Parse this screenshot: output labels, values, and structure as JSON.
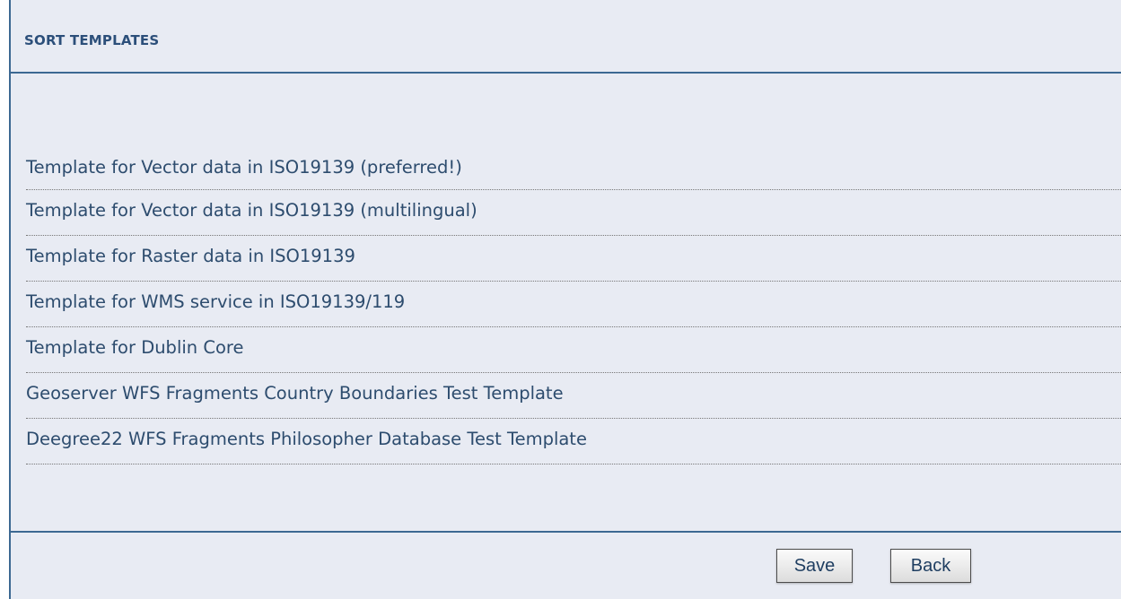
{
  "panel": {
    "title": "SORT TEMPLATES"
  },
  "templates": [
    {
      "label": "Template for Vector data in ISO19139 (preferred!)"
    },
    {
      "label": "Template for Vector data in ISO19139 (multilingual)"
    },
    {
      "label": "Template for Raster data in ISO19139"
    },
    {
      "label": "Template for WMS service in ISO19139/119"
    },
    {
      "label": "Template for Dublin Core"
    },
    {
      "label": "Geoserver WFS Fragments Country Boundaries Test Template"
    },
    {
      "label": "Deegree22 WFS Fragments Philosopher Database Test Template"
    }
  ],
  "buttons": {
    "save_label": "Save",
    "back_label": "Back"
  },
  "colors": {
    "panel_background": "#e8ebf3",
    "border": "#3c6892",
    "title_text": "#2c4f7a",
    "item_text": "#2d4c6e"
  }
}
